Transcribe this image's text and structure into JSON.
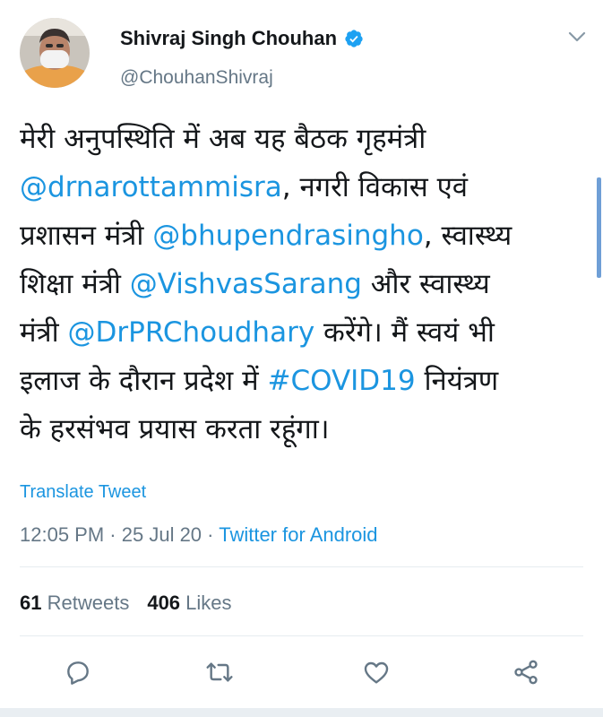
{
  "user": {
    "name": "Shivraj Singh Chouhan",
    "handle": "@ChouhanShivraj"
  },
  "tweet": {
    "lines": [
      [
        {
          "t": "मेरी अनुपस्थिति में अब यह बैठक गृहमंत्री"
        }
      ],
      [
        {
          "t": "@drnarottammisra",
          "link": true
        },
        {
          "t": ", नगरी विकास एवं"
        }
      ],
      [
        {
          "t": "प्रशासन मंत्री "
        },
        {
          "t": "@bhupendrasingho",
          "link": true
        },
        {
          "t": ", स्वास्थ्य"
        }
      ],
      [
        {
          "t": "शिक्षा मंत्री "
        },
        {
          "t": "@VishvasSarang",
          "link": true
        },
        {
          "t": " और स्वास्थ्य"
        }
      ],
      [
        {
          "t": "मंत्री "
        },
        {
          "t": "@DrPRChoudhary",
          "link": true
        },
        {
          "t": " करेंगे। मैं स्वयं भी"
        }
      ],
      [
        {
          "t": "इलाज के दौरान प्रदेश में "
        },
        {
          "t": "#COVID19",
          "link": true
        },
        {
          "t": " नियंत्रण"
        }
      ],
      [
        {
          "t": "के हरसंभव प्रयास करता रहूंगा।"
        }
      ]
    ],
    "translate_label": "Translate Tweet",
    "time": "12:05 PM",
    "separator": "·",
    "date": "25 Jul 20",
    "source": "Twitter for Android"
  },
  "stats": {
    "retweets_count": "61",
    "retweets_label": "Retweets",
    "likes_count": "406",
    "likes_label": "Likes"
  },
  "icons": {
    "reply": "reply-icon",
    "retweet": "retweet-icon",
    "like": "like-icon",
    "share": "share-icon",
    "verified": "verified-badge-icon",
    "chevron": "chevron-down-icon"
  },
  "colors": {
    "link": "#1b95e0",
    "secondary": "#657786",
    "primary": "#14171a",
    "divider": "#e6ecf0"
  }
}
